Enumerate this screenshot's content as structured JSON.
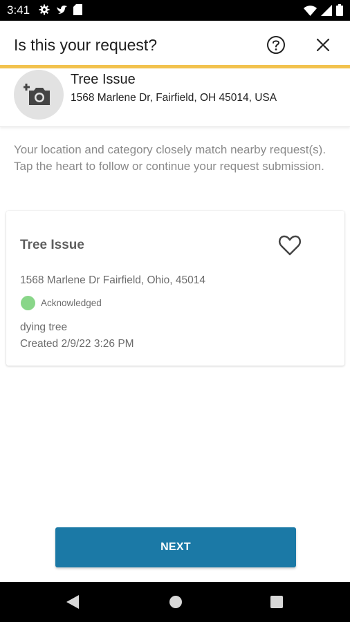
{
  "status_bar": {
    "time": "3:41",
    "left_icons": [
      "gear-icon",
      "bird-icon",
      "sd-card-icon"
    ],
    "right_icons": [
      "wifi-icon",
      "cellular-signal-icon",
      "battery-icon"
    ]
  },
  "header": {
    "title": "Is this your request?",
    "help_icon": "help-circle-icon",
    "close_icon": "close-icon",
    "accent_color": "#f2c24e"
  },
  "summary": {
    "photo_icon": "add-photo-camera-icon",
    "title": "Tree Issue",
    "address": "1568 Marlene Dr, Fairfield, OH 45014, USA"
  },
  "intro_text": "Your location and category closely match nearby request(s). Tap the heart to follow or continue your request submission.",
  "matches": [
    {
      "title": "Tree Issue",
      "address": "1568 Marlene Dr Fairfield, Ohio, 45014",
      "status": "Acknowledged",
      "status_color": "#89d689",
      "description": "dying tree",
      "created": "Created 2/9/22 3:26 PM",
      "follow_icon": "heart-outline-icon"
    }
  ],
  "footer": {
    "next_label": "NEXT",
    "button_color": "#1b79a6"
  },
  "nav_bar": {
    "icons": [
      "back-triangle-icon",
      "home-circle-icon",
      "recents-square-icon"
    ]
  }
}
